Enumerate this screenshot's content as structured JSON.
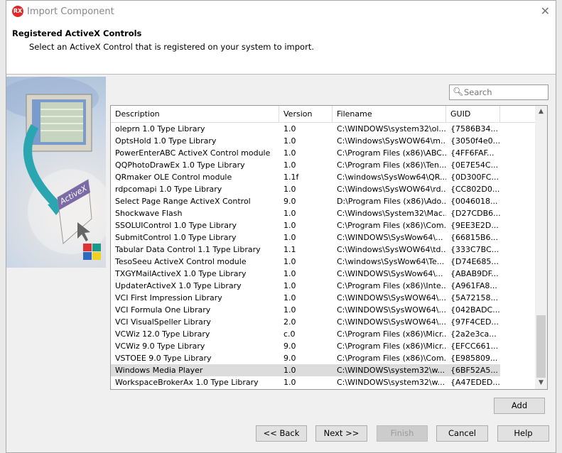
{
  "window": {
    "title": "Import Component",
    "logo": "RX",
    "close_icon": "close-icon"
  },
  "header": {
    "title": "Registered ActiveX Controls",
    "subtitle": "Select an ActiveX Control that is registered on your system to import."
  },
  "art": {
    "label": "ActiveX"
  },
  "search": {
    "placeholder": "Search",
    "value": ""
  },
  "table": {
    "columns": [
      "Description",
      "Version",
      "Filename",
      "GUID"
    ],
    "selected_index": 20,
    "rows": [
      [
        "oleprn 1.0 Type Library",
        "1.0",
        "C:\\WINDOWS\\system32\\ol...",
        "{7586B34..."
      ],
      [
        "OptsHold 1.0 Type Library",
        "1.0",
        "C:\\Windows\\SysWOW64\\m...",
        "{3050f4e0..."
      ],
      [
        "PowerEnterABC ActiveX Control module",
        "1.0",
        "C:\\Program Files (x86)\\ABC...",
        "{4FF6FAF..."
      ],
      [
        "QQPhotoDrawEx 1.0 Type Library",
        "1.0",
        "C:\\Program Files (x86)\\Ten...",
        "{0E7E54C..."
      ],
      [
        "QRmaker OLE Control module",
        "1.1f",
        "C:\\windows\\SysWow64\\QR...",
        "{0D300FC..."
      ],
      [
        "rdpcomapi 1.0 Type Library",
        "1.0",
        "C:\\Windows\\SysWOW64\\rd...",
        "{CC802D0..."
      ],
      [
        "Select Page Range ActiveX Control",
        "9.0",
        "D:\\Program Files (x86)\\Ado...",
        "{0046018..."
      ],
      [
        "Shockwave Flash",
        "1.0",
        "C:\\Windows\\System32\\Mac...",
        "{D27CDB6..."
      ],
      [
        "SSOLUIControl 1.0 Type Library",
        "1.0",
        "C:\\Program Files (x86)\\Com...",
        "{9EE3E2D..."
      ],
      [
        "SubmitControl 1.0 Type Library",
        "1.0",
        "C:\\WINDOWS\\SysWow64\\...",
        "{66815B6..."
      ],
      [
        "Tabular Data Control 1.1 Type Library",
        "1.1",
        "C:\\Windows\\SysWOW64\\td...",
        "{333C7BC..."
      ],
      [
        "TesoSeeu ActiveX Control module",
        "1.0",
        "C:\\windows\\SysWow64\\Te...",
        "{D74E685..."
      ],
      [
        "TXGYMailActiveX 1.0 Type Library",
        "1.0",
        "C:\\WINDOWS\\SysWow64\\...",
        "{ABAB9DF..."
      ],
      [
        "UpdaterActiveX 1.0 Type Library",
        "1.0",
        "C:\\Program Files (x86)\\Inte...",
        "{A961FA8..."
      ],
      [
        "VCI First Impression Library",
        "1.0",
        "C:\\WINDOWS\\SysWOW64\\...",
        "{5A72158..."
      ],
      [
        "VCI Formula One Library",
        "1.0",
        "C:\\WINDOWS\\SysWOW64\\...",
        "{042BADC..."
      ],
      [
        "VCI VisualSpeller Library",
        "2.0",
        "C:\\WINDOWS\\SysWOW64\\...",
        "{97F4CED..."
      ],
      [
        "VCWiz 12.0 Type Library",
        "c.0",
        "C:\\Program Files (x86)\\Micr...",
        "{2a2e3ca..."
      ],
      [
        "VCWiz 9.0 Type Library",
        "9.0",
        "C:\\Program Files (x86)\\Micr...",
        "{EFCC661..."
      ],
      [
        "VSTOEE 9.0 Type Library",
        "9.0",
        "C:\\Program Files (x86)\\Com...",
        "{E985809..."
      ],
      [
        "Windows Media Player",
        "1.0",
        "C:\\WINDOWS\\system32\\w...",
        "{6BF52A5..."
      ],
      [
        "WorkspaceBrokerAx 1.0 Type Library",
        "1.0",
        "C:\\WINDOWS\\system32\\w...",
        "{A47EDED..."
      ]
    ]
  },
  "buttons": {
    "add": "Add",
    "back": "<< Back",
    "next": "Next >>",
    "finish": "Finish",
    "cancel": "Cancel",
    "help": "Help"
  }
}
